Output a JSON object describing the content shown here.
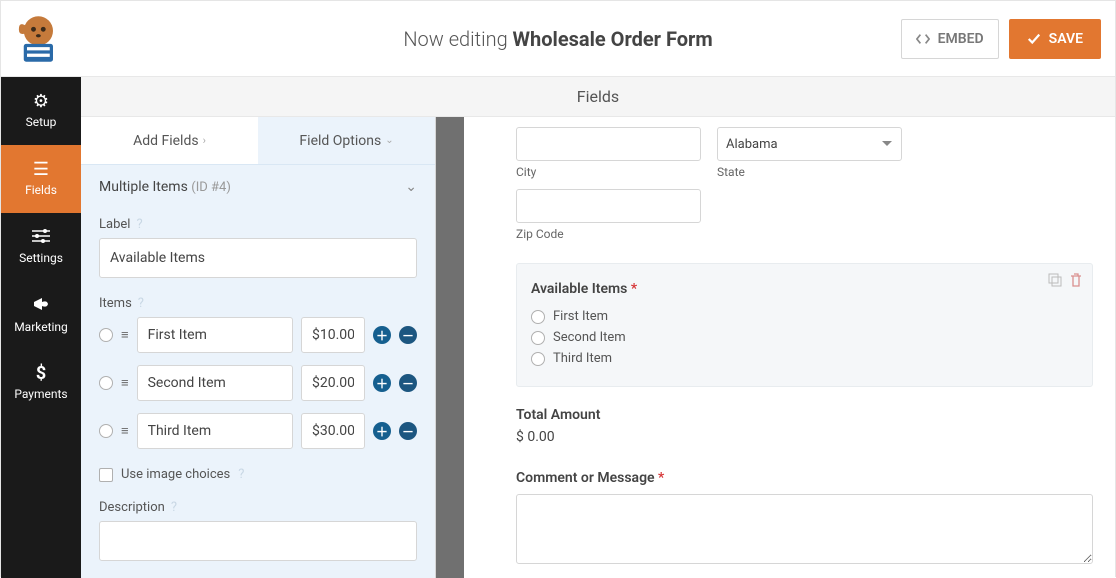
{
  "header": {
    "editing_prefix": "Now editing ",
    "form_name": "Wholesale Order Form",
    "embed_label": "EMBED",
    "save_label": "SAVE"
  },
  "nav": {
    "setup": "Setup",
    "fields": "Fields",
    "settings": "Settings",
    "marketing": "Marketing",
    "payments": "Payments"
  },
  "editor_header": "Fields",
  "panel": {
    "tab_add": "Add Fields",
    "tab_options": "Field Options",
    "section_title": "Multiple Items",
    "section_id": "(ID #4)",
    "label_label": "Label",
    "label_value": "Available Items",
    "items_label": "Items",
    "items": [
      {
        "name": "First Item",
        "price": "$10.00"
      },
      {
        "name": "Second Item",
        "price": "$20.00"
      },
      {
        "name": "Third Item",
        "price": "$30.00"
      }
    ],
    "image_choices_label": "Use image choices",
    "description_label": "Description"
  },
  "preview": {
    "state_value": "Alabama",
    "city_label": "City",
    "state_label": "State",
    "zip_label": "Zip Code",
    "available_items_label": "Available Items",
    "items": [
      "First Item",
      "Second Item",
      "Third Item"
    ],
    "total_label": "Total Amount",
    "total_value": "$ 0.00",
    "comment_label": "Comment or Message"
  }
}
